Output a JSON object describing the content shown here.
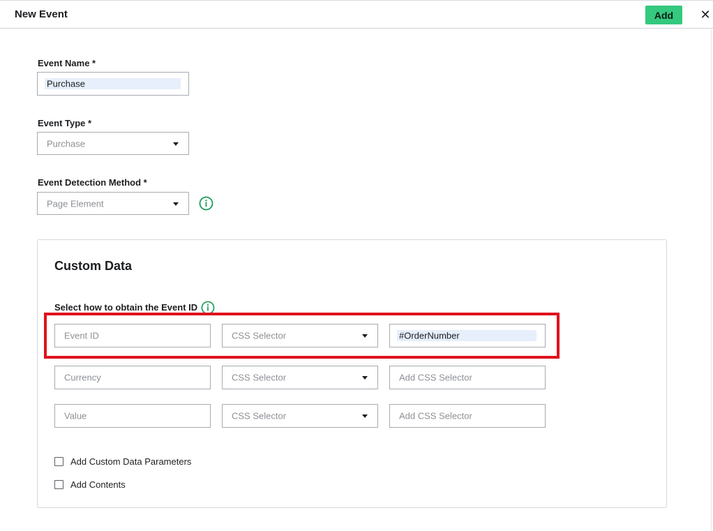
{
  "header": {
    "title": "New Event",
    "add_label": "Add",
    "close_glyph": "✕"
  },
  "form": {
    "event_name": {
      "label": "Event Name *",
      "value": "Purchase"
    },
    "event_type": {
      "label": "Event Type *",
      "value": "Purchase"
    },
    "detection_method": {
      "label": "Event Detection Method *",
      "value": "Page Element"
    }
  },
  "custom_data": {
    "title": "Custom Data",
    "event_id_prompt": "Select how to obtain the Event ID",
    "rows": [
      {
        "param_placeholder": "Event ID",
        "method": "CSS Selector",
        "selector_value": "#OrderNumber",
        "selector_placeholder": ""
      },
      {
        "param_placeholder": "Currency",
        "method": "CSS Selector",
        "selector_value": "",
        "selector_placeholder": "Add CSS Selector"
      },
      {
        "param_placeholder": "Value",
        "method": "CSS Selector",
        "selector_value": "",
        "selector_placeholder": "Add CSS Selector"
      }
    ],
    "checkboxes": [
      {
        "label": "Add Custom Data Parameters",
        "checked": false
      },
      {
        "label": "Add Contents",
        "checked": false
      }
    ]
  },
  "colors": {
    "accent_green": "#35c97f",
    "info_icon_green": "#1a9e5c",
    "highlight_red": "#e0111d"
  },
  "icons": [
    "info-icon",
    "close-icon",
    "caret-down-icon"
  ]
}
